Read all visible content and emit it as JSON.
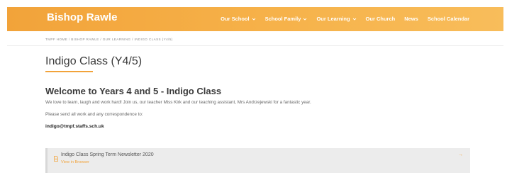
{
  "header": {
    "brand": "Bishop Rawle",
    "nav": [
      {
        "label": "Our School",
        "has_dropdown": true
      },
      {
        "label": "School Family",
        "has_dropdown": true
      },
      {
        "label": "Our Learning",
        "has_dropdown": true
      },
      {
        "label": "Our Church",
        "has_dropdown": false
      },
      {
        "label": "News",
        "has_dropdown": false
      },
      {
        "label": "School Calendar",
        "has_dropdown": false
      }
    ]
  },
  "breadcrumb": "TMPF HOME / BISHOP RAWLE / OUR LEARNING / INDIGO CLASS (Y4/5)",
  "page": {
    "title": "Indigo Class (Y4/5)",
    "heading": "Welcome to Years 4 and 5 - Indigo Class",
    "paragraph1": "We love to learn, laugh and work hard! Join us, our teacher Miss Kirk and our teaching assistant, Mrs Andrzejewski for a fantastic year.",
    "paragraph2": "Please send all work and any correspondence to:",
    "email": "indigo@tmpf.staffs.sch.uk"
  },
  "attachment": {
    "title": "Indigo Class Spring Term Newsletter 2020",
    "link_label": "View in Browser",
    "icon": "document-icon",
    "arrow": "→"
  },
  "colors": {
    "accent": "#f2a33a",
    "header_gradient_end": "#f8bd5b",
    "attachment_bg": "#ececec"
  }
}
